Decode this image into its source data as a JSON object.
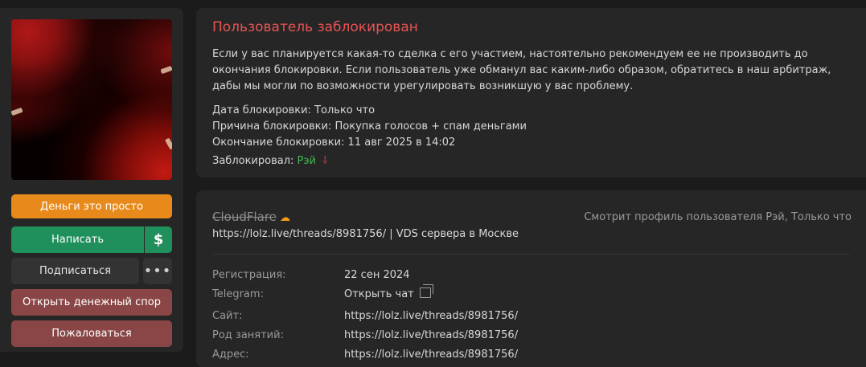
{
  "sidebar": {
    "buttons": {
      "money": "Деньги это просто",
      "write": "Написать",
      "dollar": "$",
      "subscribe": "Подписаться",
      "more": "•••",
      "dispute": "Открыть денежный спор",
      "report": "Пожаловаться"
    }
  },
  "ban": {
    "title": "Пользователь заблокирован",
    "description": "Если у вас планируется какая-то сделка с его участием, настоятельно рекомендуем ее не производить до окончания блокировки. Если пользователь уже обманул вас каким-либо образом, обратитесь в наш арбитраж, дабы мы могли по возможности урегулировать возникшую у вас проблему.",
    "date_label": "Дата блокировки:",
    "date_value": "Только что",
    "reason_label": "Причина блокировки:",
    "reason_value": "Покупка голосов + спам деньгами",
    "end_label": "Окончание блокировки:",
    "end_value": "11 авг 2025 в 14:02",
    "by_label": "Заблокировал:",
    "by_value": "Рэй",
    "by_icon": "⸸"
  },
  "profile": {
    "name": "CloudFlare",
    "cloud_icon": "☁",
    "viewing": "Смотрит профиль пользователя Рэй, Только что",
    "status": "https://lolz.live/threads/8981756/ | VDS сервера в Москве",
    "rows": [
      {
        "label": "Регистрация:",
        "value": "22 сен 2024"
      },
      {
        "label": "Telegram:",
        "value": "Открыть чат"
      },
      {
        "label": "Сайт:",
        "value": "https://lolz.live/threads/8981756/"
      },
      {
        "label": "Род занятий:",
        "value": "https://lolz.live/threads/8981756/"
      },
      {
        "label": "Адрес:",
        "value": "https://lolz.live/threads/8981756/"
      }
    ]
  },
  "colors": {
    "ban_title": "#e85454",
    "green_button": "#1f8f5b",
    "orange_button": "#e88a1b",
    "danger_button": "#8a4646",
    "moderator_name": "#3fb950"
  }
}
